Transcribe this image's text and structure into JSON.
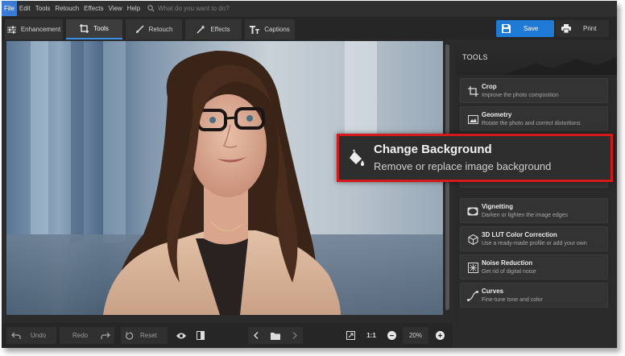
{
  "menu": {
    "items": [
      "File",
      "Edit",
      "Tools",
      "Retouch",
      "Effects",
      "View",
      "Help"
    ],
    "search_placeholder": "What do you want to do?"
  },
  "tabs": [
    {
      "label": "Enhancement",
      "icon": "sliders-icon"
    },
    {
      "label": "Tools",
      "icon": "crop-icon"
    },
    {
      "label": "Retouch",
      "icon": "brush-icon"
    },
    {
      "label": "Effects",
      "icon": "magic-wand-icon"
    },
    {
      "label": "Captions",
      "icon": "text-icon"
    }
  ],
  "active_tab": "Tools",
  "header_buttons": {
    "save": "Save",
    "print": "Print"
  },
  "panel": {
    "title": "TOOLS",
    "tools": [
      {
        "name": "Crop",
        "desc": "Improve the photo composition",
        "icon": "crop-icon"
      },
      {
        "name": "Geometry",
        "desc": "Rotate the photo and correct distortions",
        "icon": "geometry-icon"
      },
      {
        "name": "Vignetting",
        "desc": "Darken or lighten the image edges",
        "icon": "vignette-icon"
      },
      {
        "name": "3D LUT Color Correction",
        "desc": "Use a ready-made profile or add your own",
        "icon": "cube-icon"
      },
      {
        "name": "Noise Reduction",
        "desc": "Get rid of digital noise",
        "icon": "noise-icon"
      },
      {
        "name": "Curves",
        "desc": "Fine-tune tone and color",
        "icon": "curves-icon"
      }
    ]
  },
  "highlight": {
    "name": "Change Background",
    "desc": "Remove or replace image background",
    "icon": "paint-bucket-icon"
  },
  "bottom": {
    "undo": "Undo",
    "redo": "Redo",
    "reset": "Reset",
    "zoom_ratio": "1:1",
    "zoom_level": "20%"
  },
  "colors": {
    "accent": "#1f7ad6",
    "highlight_border": "#d21a1a"
  }
}
